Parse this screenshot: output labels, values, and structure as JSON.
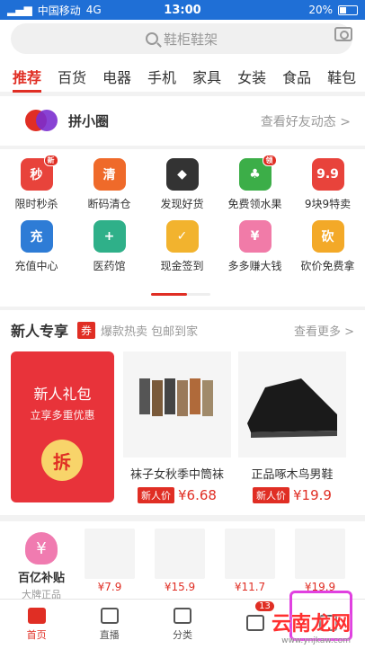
{
  "status_bar": {
    "carrier": "中国移动",
    "network": "4G",
    "time": "13:00",
    "battery": "20%"
  },
  "search": {
    "placeholder": "鞋柜鞋架"
  },
  "tabs": [
    "推荐",
    "百货",
    "电器",
    "手机",
    "家具",
    "女装",
    "食品",
    "鞋包"
  ],
  "circle": {
    "title": "拼小圈",
    "link": "查看好友动态 >"
  },
  "grid": {
    "row1": [
      {
        "label": "限时秒杀",
        "glyph": "秒",
        "color": "#e8433b",
        "badge": "新"
      },
      {
        "label": "断码清仓",
        "glyph": "清",
        "color": "#ef6a2a"
      },
      {
        "label": "发现好货",
        "glyph": "◆",
        "color": "#333333"
      },
      {
        "label": "免费领水果",
        "glyph": "♣",
        "color": "#3cae48",
        "badge": "领"
      },
      {
        "label": "9块9特卖",
        "glyph": "9.9",
        "color": "#e8433b"
      }
    ],
    "row2": [
      {
        "label": "充值中心",
        "glyph": "充",
        "color": "#2e7cd6"
      },
      {
        "label": "医药馆",
        "glyph": "+",
        "color": "#2fb089"
      },
      {
        "label": "现金签到",
        "glyph": "✓",
        "color": "#f2b32e"
      },
      {
        "label": "多多赚大钱",
        "glyph": "¥",
        "color": "#f17ba8"
      },
      {
        "label": "砍价免费拿",
        "glyph": "砍",
        "color": "#f3a928"
      }
    ]
  },
  "newbie": {
    "title": "新人专享",
    "tag": "券",
    "subtitle": "爆款热卖 包邮到家",
    "more": "查看更多 >",
    "gift_title": "新人礼包",
    "gift_sub": "立享多重优惠",
    "gift_button": "拆",
    "products": [
      {
        "name": "袜子女秋季中筒袜",
        "tag": "新人价",
        "price": "¥6.68"
      },
      {
        "name": "正品啄木鸟男鞋",
        "tag": "新人价",
        "price": "¥19.9"
      }
    ]
  },
  "subsidy": {
    "title": "百亿补贴",
    "sub": "大牌正品",
    "bag_glyph": "¥"
  },
  "strip_prices": [
    "¥7.9",
    "¥15.9",
    "¥11.7",
    "¥19.9"
  ],
  "nav": {
    "items": [
      "首页",
      "直播",
      "分类",
      "",
      ""
    ],
    "badge": "13"
  },
  "watermark": {
    "text": "云南龙网",
    "url": "www.ynjkaw.com"
  },
  "colors": {
    "accent": "#e02e24",
    "status_bar": "#1f6fd6"
  }
}
